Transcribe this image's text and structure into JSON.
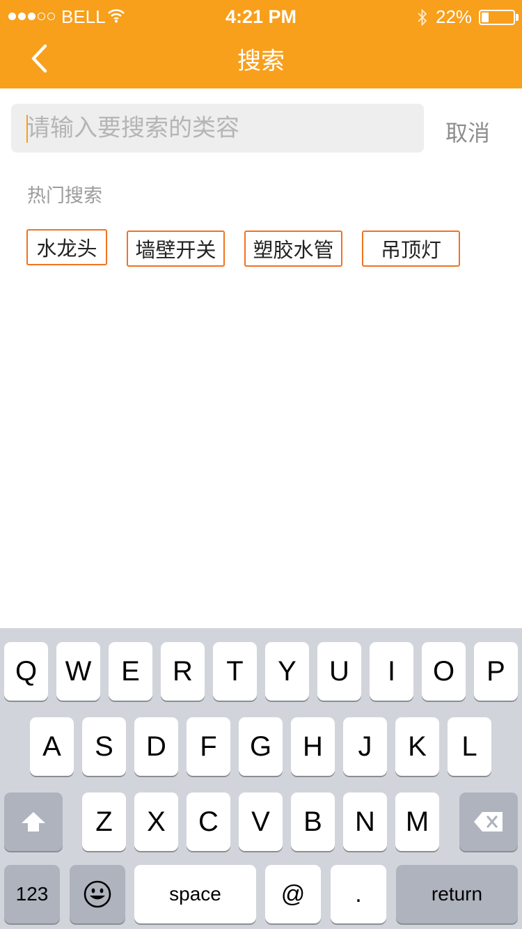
{
  "status_bar": {
    "carrier": "BELL",
    "time": "4:21 PM",
    "battery": "22%",
    "battery_level": 0.22,
    "signal_bars": 3,
    "signal_total": 5,
    "icons": [
      "signal-dots-icon",
      "wifi-icon",
      "bluetooth-icon",
      "battery-icon"
    ]
  },
  "nav": {
    "title": "搜索",
    "back_icon": "chevron-left-icon"
  },
  "search": {
    "placeholder": "请输入要搜索的类容",
    "value": "",
    "cancel_label": "取消"
  },
  "hot": {
    "title": "热门搜索",
    "tags": [
      "水龙头",
      "墙壁开关",
      "塑胶水管",
      "吊顶灯"
    ]
  },
  "keyboard": {
    "row1": [
      "Q",
      "W",
      "E",
      "R",
      "T",
      "Y",
      "U",
      "I",
      "O",
      "P"
    ],
    "row2": [
      "A",
      "S",
      "D",
      "F",
      "G",
      "H",
      "J",
      "K",
      "L"
    ],
    "row3": [
      "Z",
      "X",
      "C",
      "V",
      "B",
      "N",
      "M"
    ],
    "numbers_label": "123",
    "space_label": "space",
    "at_label": "@",
    "period_label": ".",
    "return_label": "return",
    "shift_icon": "shift-arrow-icon",
    "delete_icon": "backspace-icon",
    "emoji_icon": "emoji-face-icon"
  },
  "colors": {
    "header": "#f89f1b",
    "tag_border": "#f0731f",
    "keyboard_bg": "#d1d5db"
  }
}
